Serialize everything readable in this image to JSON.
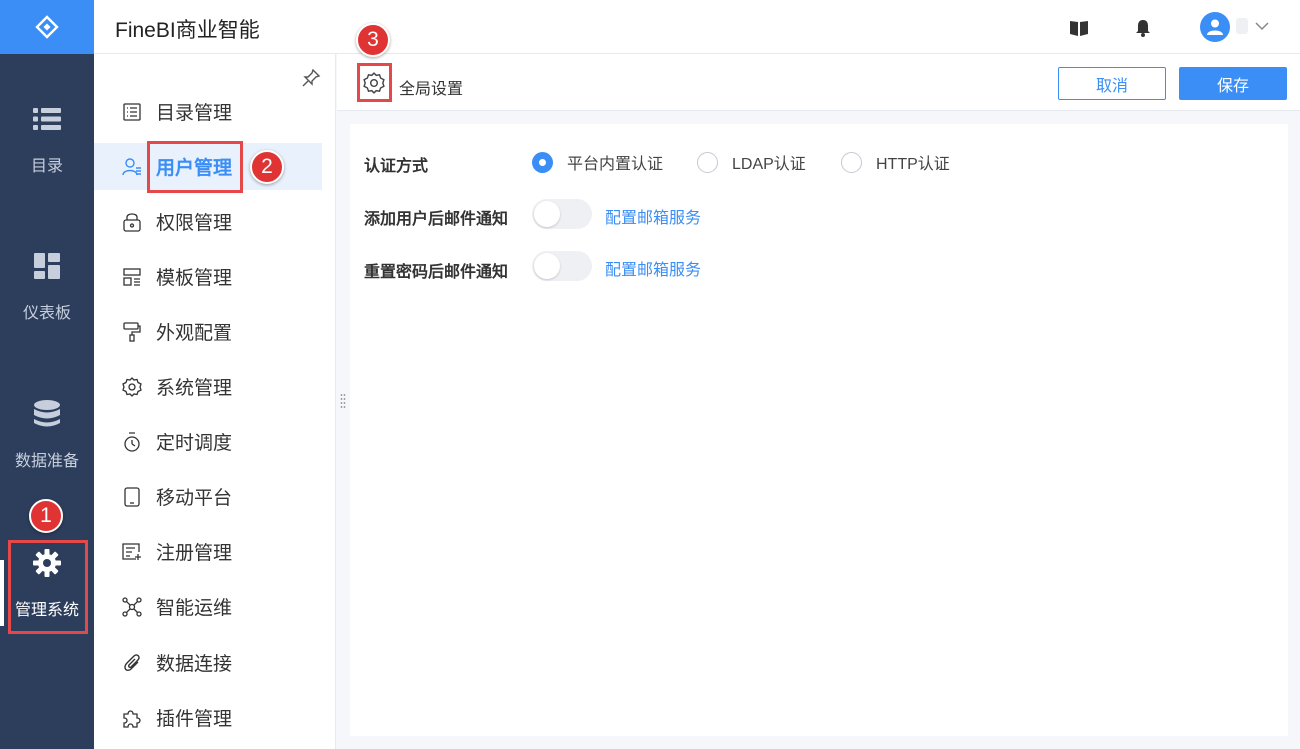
{
  "header": {
    "app_title": "FineBI商业智能"
  },
  "rail": {
    "items": [
      {
        "label": "目录",
        "icon": "list-icon"
      },
      {
        "label": "仪表板",
        "icon": "dashboard-icon"
      },
      {
        "label": "数据准备",
        "icon": "database-icon"
      },
      {
        "label": "管理系统",
        "icon": "gear-icon"
      }
    ]
  },
  "menu": {
    "items": [
      {
        "label": "目录管理",
        "icon": "catalog-icon"
      },
      {
        "label": "用户管理",
        "icon": "user-icon"
      },
      {
        "label": "权限管理",
        "icon": "lock-icon"
      },
      {
        "label": "模板管理",
        "icon": "template-icon"
      },
      {
        "label": "外观配置",
        "icon": "paint-roller-icon"
      },
      {
        "label": "系统管理",
        "icon": "gear-icon"
      },
      {
        "label": "定时调度",
        "icon": "timer-icon"
      },
      {
        "label": "移动平台",
        "icon": "mobile-icon"
      },
      {
        "label": "注册管理",
        "icon": "register-icon"
      },
      {
        "label": "智能运维",
        "icon": "network-icon"
      },
      {
        "label": "数据连接",
        "icon": "paperclip-icon"
      },
      {
        "label": "插件管理",
        "icon": "puzzle-icon"
      }
    ]
  },
  "toolbar": {
    "title": "全局设置",
    "cancel_label": "取消",
    "save_label": "保存"
  },
  "settings": {
    "auth": {
      "label": "认证方式",
      "options": [
        "平台内置认证",
        "LDAP认证",
        "HTTP认证"
      ],
      "selected": "平台内置认证"
    },
    "add_user_mail": {
      "label": "添加用户后邮件通知",
      "enabled": false,
      "link": "配置邮箱服务"
    },
    "reset_pwd_mail": {
      "label": "重置密码后邮件通知",
      "enabled": false,
      "link": "配置邮箱服务"
    }
  },
  "annotations": [
    "1",
    "2",
    "3"
  ],
  "colors": {
    "rail_bg": "#2c3e5c",
    "accent": "#3a8ef6",
    "annotation": "#e03434"
  }
}
